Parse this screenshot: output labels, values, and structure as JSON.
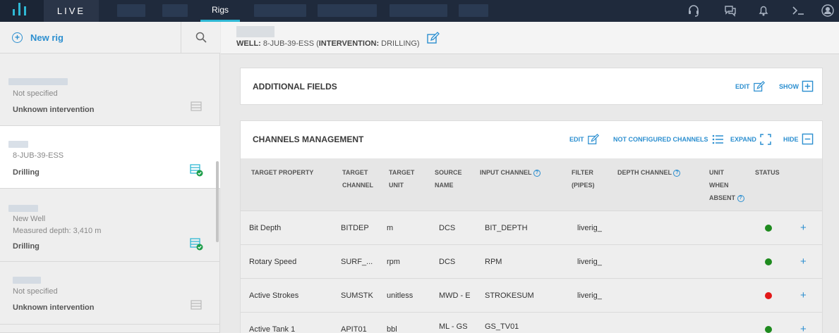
{
  "topbar": {
    "brand": "LIVE",
    "active_tab": "Rigs",
    "icons": [
      "support-headset-icon",
      "chat-icon",
      "bell-icon",
      "terminal-icon",
      "user-icon"
    ]
  },
  "sidebar": {
    "new_rig_label": "New rig",
    "cards": [
      {
        "sub1": "Not specified",
        "sub2": "",
        "intervention": "Unknown intervention",
        "icon": "list-icon"
      },
      {
        "sub1": "8-JUB-39-ESS",
        "sub2": "",
        "intervention": "Drilling",
        "icon": "list-check-icon"
      },
      {
        "sub1": "New Well",
        "sub2": "Measured depth: 3,410 m",
        "intervention": "Drilling",
        "icon": "list-check-icon"
      },
      {
        "sub1": "Not specified",
        "sub2": "",
        "intervention": "Unknown intervention",
        "icon": "list-icon"
      }
    ]
  },
  "header": {
    "well_label": "WELL:",
    "well_value": "8-JUB-39-ESS (",
    "intervention_label": "INTERVENTION:",
    "intervention_value": " DRILLING)"
  },
  "additional_fields": {
    "title": "ADDITIONAL FIELDS",
    "edit_label": "EDIT",
    "show_label": "SHOW"
  },
  "channels": {
    "title": "CHANNELS MANAGEMENT",
    "edit_label": "EDIT",
    "not_configured_label": "NOT CONFIGURED CHANNELS",
    "expand_label": "EXPAND",
    "hide_label": "HIDE",
    "columns": {
      "target_property": "TARGET PROPERTY",
      "target_channel_1": "TARGET",
      "target_channel_2": "CHANNEL",
      "target_unit_1": "TARGET",
      "target_unit_2": "UNIT",
      "source_name_1": "SOURCE",
      "source_name_2": "NAME",
      "input_channel": "INPUT CHANNEL",
      "filter_1": "FILTER",
      "filter_2": "(PIPES)",
      "depth_channel": "DEPTH CHANNEL",
      "unit_absent_1": "UNIT",
      "unit_absent_2": "WHEN",
      "unit_absent_3": "ABSENT",
      "status": "STATUS"
    },
    "rows": [
      {
        "property": "Bit Depth",
        "channel": "BITDEP",
        "unit": "m",
        "source": "DCS",
        "input": "BIT_DEPTH",
        "filter": "liverig_",
        "status": "green"
      },
      {
        "property": "Rotary Speed",
        "channel": "SURF_...",
        "unit": "rpm",
        "source": "DCS",
        "input": "RPM",
        "filter": "liverig_",
        "status": "green"
      },
      {
        "property": "Active Strokes",
        "channel": "SUMSTK",
        "unit": "unitless",
        "source": "MWD - E",
        "input": "STROKESUM",
        "filter": "liverig_",
        "status": "red"
      },
      {
        "property": "Active Tank 1",
        "channel": "APIT01",
        "unit": "bbl",
        "source": "ML - GS",
        "input": "GS_TV01",
        "filter": "",
        "status": "green"
      }
    ]
  },
  "colors": {
    "accent": "#2c8fd0",
    "teal": "#2fb8d4",
    "green": "#1e8a1e",
    "red": "#e21818"
  }
}
